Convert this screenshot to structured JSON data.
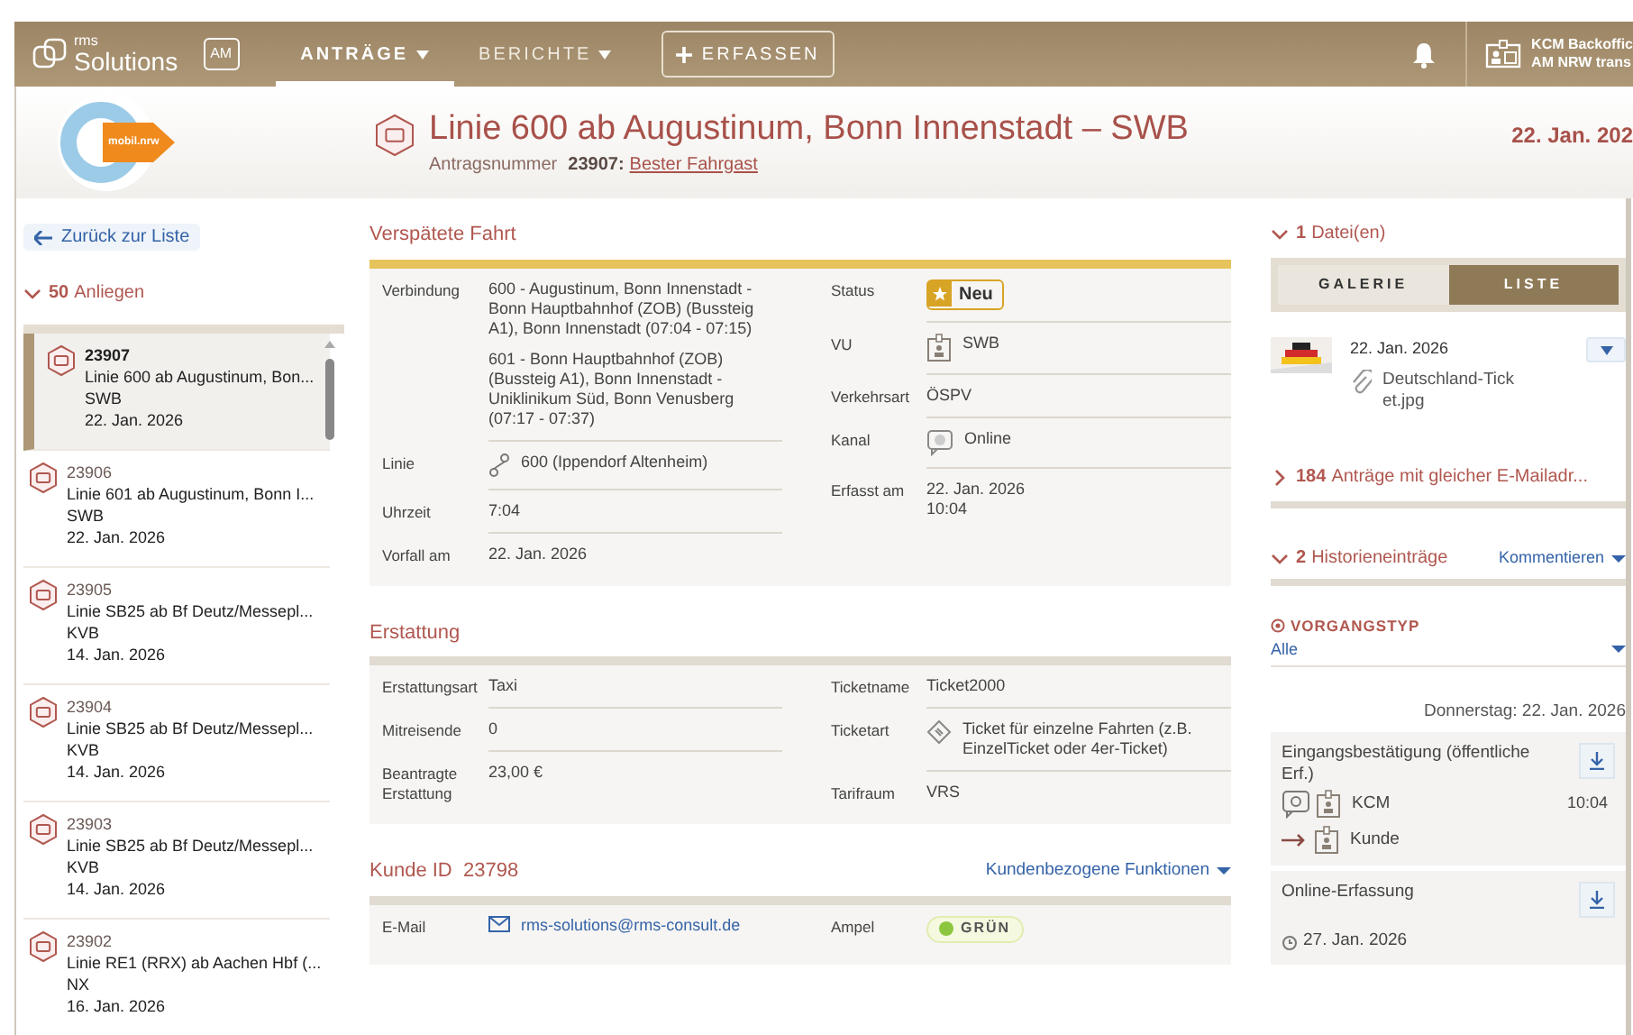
{
  "nav": {
    "brand_top": "rms",
    "brand": "Solutions",
    "badge": "AM",
    "menus": [
      {
        "label": "ANTRÄGE",
        "selected": true
      },
      {
        "label": "BERICHTE",
        "selected": false
      }
    ],
    "create": "ERFASSEN",
    "user": [
      "KCM Backoffic",
      "AM NRW trans"
    ]
  },
  "header": {
    "logo_text": "mobil.nrw",
    "title": "Linie 600 ab Augustinum, Bonn Innenstadt – SWB",
    "number_label": "Antragsnummer",
    "number": "23907:",
    "link": "Bester Fahrgast",
    "date": "22. Jan. 202"
  },
  "sidebar": {
    "back": "Zurück zur Liste",
    "count": "50",
    "count_label": "Anliegen",
    "expanded": true,
    "items": [
      {
        "number": "23907",
        "title": "Linie 600 ab Augustinum, Bon...",
        "operator": "SWB",
        "date": "22. Jan. 2026",
        "selected": true
      },
      {
        "number": "23906",
        "title": "Linie 601 ab Augustinum, Bonn I...",
        "operator": "SWB",
        "date": "22. Jan. 2026",
        "selected": false
      },
      {
        "number": "23905",
        "title": "Linie SB25 ab Bf Deutz/Messepl...",
        "operator": "KVB",
        "date": "14. Jan. 2026",
        "selected": false
      },
      {
        "number": "23904",
        "title": "Linie SB25 ab Bf Deutz/Messepl...",
        "operator": "KVB",
        "date": "14. Jan. 2026",
        "selected": false
      },
      {
        "number": "23903",
        "title": "Linie SB25 ab Bf Deutz/Messepl...",
        "operator": "KVB",
        "date": "14. Jan. 2026",
        "selected": false
      },
      {
        "number": "23902",
        "title": "Linie RE1 (RRX) ab Aachen Hbf (...",
        "operator": "NX",
        "date": "16. Jan. 2026",
        "selected": false
      }
    ]
  },
  "sections": [
    {
      "title": "Verspätete Fahrt",
      "highlighted": true,
      "left": [
        {
          "label": "Verbindung",
          "kind": "text",
          "values": [
            "600 - Augustinum, Bonn Innenstadt - Bonn Hauptbahnhof (ZOB) (Bussteig A1), Bonn Innenstadt (07:04 - 07:15)",
            "601 - Bonn Hauptbahnhof (ZOB) (Bussteig A1), Bonn Innenstadt - Uniklinikum Süd, Bonn Venusberg (07:17 - 07:37)"
          ]
        },
        {
          "label": "Linie",
          "kind": "route",
          "values": [
            "600 (Ippendorf Altenheim)"
          ]
        },
        {
          "label": "Uhrzeit",
          "kind": "text",
          "values": [
            "7:04"
          ]
        },
        {
          "label": "Vorfall am",
          "kind": "text",
          "values": [
            "22. Jan. 2026"
          ]
        }
      ],
      "right": [
        {
          "label": "Status",
          "kind": "badge",
          "values": [
            "Neu"
          ]
        },
        {
          "label": "VU",
          "kind": "operator",
          "values": [
            "SWB"
          ]
        },
        {
          "label": "Verkehrsart",
          "kind": "text",
          "values": [
            "ÖSPV"
          ]
        },
        {
          "label": "Kanal",
          "kind": "channel",
          "values": [
            "Online"
          ]
        },
        {
          "label": "Erfasst am",
          "kind": "text",
          "values": [
            "22. Jan. 2026",
            "10:04"
          ]
        }
      ]
    },
    {
      "title": "Erstattung",
      "highlighted": false,
      "left": [
        {
          "label": "Erstattungsart",
          "kind": "text",
          "values": [
            "Taxi"
          ]
        },
        {
          "label": "Mitreisende",
          "kind": "text",
          "values": [
            "0"
          ]
        },
        {
          "label": "Beantragte Erstattung",
          "kind": "text",
          "values": [
            "23,00 €"
          ]
        }
      ],
      "right": [
        {
          "label": "Ticketname",
          "kind": "text",
          "values": [
            "Ticket2000"
          ]
        },
        {
          "label": "Ticketart",
          "kind": "ticket",
          "values": [
            "Ticket für einzelne Fahrten (z.B. EinzelTicket oder 4er-Ticket)"
          ]
        },
        {
          "label": "Tarifraum",
          "kind": "text",
          "values": [
            "VRS"
          ]
        }
      ]
    },
    {
      "title": "Kunde ID  23798",
      "action": "Kundenbezogene Funktionen",
      "highlighted": false,
      "left": [
        {
          "label": "E-Mail",
          "kind": "email",
          "values": [
            "rms-solutions@rms-consult.de"
          ]
        }
      ],
      "right": [
        {
          "label": "Ampel",
          "kind": "status",
          "color": "#8cc63e",
          "values": [
            "GRÜN"
          ]
        }
      ]
    }
  ],
  "files": {
    "count": "1",
    "label": "Datei(en)",
    "expanded": true,
    "views": [
      {
        "label": "GALERIE",
        "selected": false
      },
      {
        "label": "LISTE",
        "selected": true
      }
    ],
    "items": [
      {
        "date": "22. Jan. 2026",
        "name": "Deutschland-Ticket.jpg"
      }
    ]
  },
  "related": {
    "count": "184",
    "label": "Anträge mit gleicher E-Mailadr...",
    "expanded": false
  },
  "history": {
    "count": "2",
    "label": "Historieneinträge",
    "expanded": true,
    "action": "Kommentieren",
    "filter_label": "VORGANGSTYP",
    "filter_value": "Alle",
    "day": "Donnerstag: 22. Jan. 2026",
    "entries": [
      {
        "title": "Eingangsbestätigung (öffentliche Erf.)",
        "from": "KCM",
        "to": "Kunde",
        "time": "10:04"
      },
      {
        "title": "Online-Erfassung",
        "date": "27. Jan. 2026"
      }
    ]
  }
}
